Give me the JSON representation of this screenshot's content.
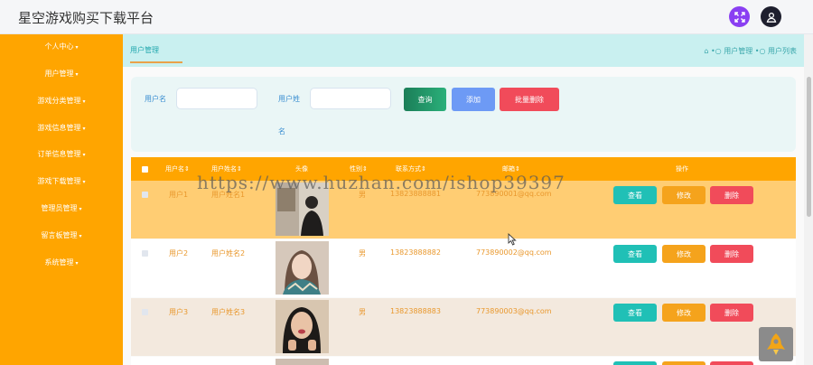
{
  "app": {
    "title": "星空游戏购买下载平台"
  },
  "header": {
    "fullscreen_icon": "fullscreen-icon",
    "user_icon": "user-icon"
  },
  "sidebar": {
    "items": [
      {
        "label": "个人中心"
      },
      {
        "label": "用户管理"
      },
      {
        "label": "游戏分类管理"
      },
      {
        "label": "游戏信息管理"
      },
      {
        "label": "订单信息管理"
      },
      {
        "label": "游戏下载管理"
      },
      {
        "label": "管理员管理"
      },
      {
        "label": "留言板管理"
      },
      {
        "label": "系统管理"
      }
    ]
  },
  "tabbar": {
    "active_tab": "用户管理",
    "breadcrumb": [
      "用户管理",
      "用户列表"
    ]
  },
  "search": {
    "username_label": "用户名",
    "username_value": "",
    "realname_label_line1": "用户姓",
    "realname_label_line2": "名",
    "realname_value": "",
    "query_button": "查询",
    "add_button": "添加",
    "batch_delete_button": "批量删除"
  },
  "table": {
    "columns": [
      "用户名",
      "用户姓名",
      "头像",
      "性别",
      "联系方式",
      "邮箱",
      "操作"
    ],
    "rows": [
      {
        "username": "用户1",
        "name": "用户姓名1",
        "gender": "男",
        "phone": "13823888881",
        "email": "773890001@qq.com"
      },
      {
        "username": "用户2",
        "name": "用户姓名2",
        "gender": "男",
        "phone": "13823888882",
        "email": "773890002@qq.com"
      },
      {
        "username": "用户3",
        "name": "用户姓名3",
        "gender": "男",
        "phone": "13823888883",
        "email": "773890003@qq.com"
      }
    ],
    "actions": {
      "view": "查看",
      "edit": "修改",
      "delete": "删除"
    }
  },
  "overlay": {
    "watermark": "https://www.huzhan.com/ishop39397"
  },
  "colors": {
    "sidebar": "#ffa500",
    "tabbar": "#c9f0f0",
    "table_header": "#ffa500",
    "view_button": "#20c0b6",
    "edit_button": "#f5a31c",
    "delete_button": "#f14b5a",
    "query_button": "#1e8e63",
    "add_button": "#6d9af5",
    "batch_delete_button": "#f14b5a"
  }
}
